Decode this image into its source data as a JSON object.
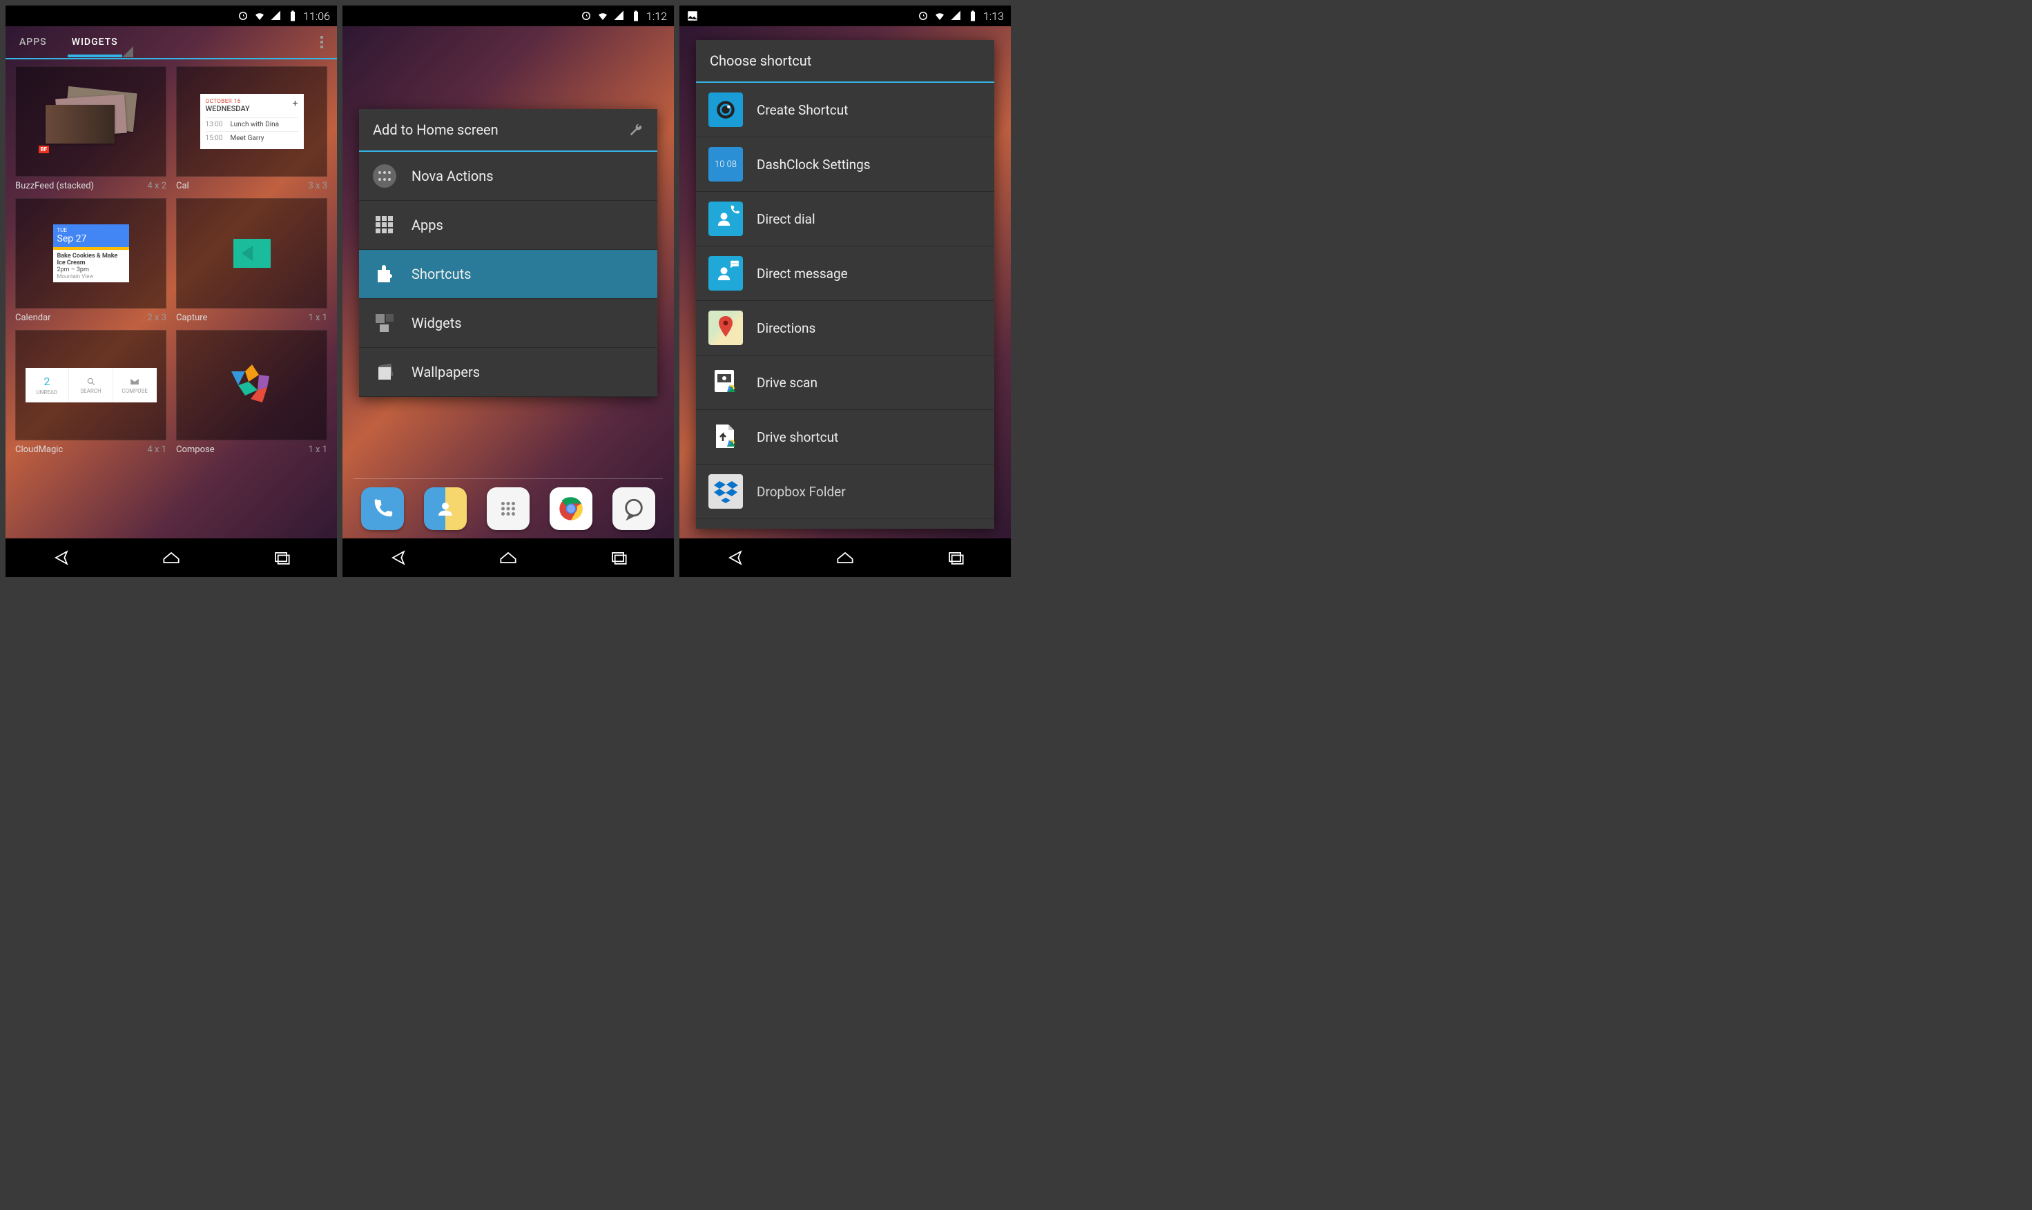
{
  "screen1": {
    "status": {
      "time": "11:06"
    },
    "tabs": {
      "apps": "APPS",
      "widgets": "WIDGETS",
      "active": "widgets"
    },
    "widgets": [
      {
        "name": "BuzzFeed (stacked)",
        "size": "4 x 2"
      },
      {
        "name": "Cal",
        "size": "3 x 3"
      },
      {
        "name": "Calendar",
        "size": "2 x 3"
      },
      {
        "name": "Capture",
        "size": "1 x 1"
      },
      {
        "name": "CloudMagic",
        "size": "4 x 1"
      },
      {
        "name": "Compose",
        "size": "1 x 1"
      }
    ],
    "cal_preview": {
      "header_small": "OCTOBER 16",
      "header_day": "WEDNESDAY",
      "rows": [
        {
          "t": "13:00",
          "e": "Lunch with Dina"
        },
        {
          "t": "15:00",
          "e": "Meet Garry"
        }
      ]
    },
    "gcal_preview": {
      "dow": "TUE",
      "date": "Sep 27",
      "event": "Bake Cookies & Make Ice Cream",
      "time": "2pm – 3pm",
      "loc": "Mountain View"
    },
    "cloudmagic": {
      "unread_n": "2",
      "unread": "UNREAD",
      "search": "SEARCH",
      "compose": "COMPOSE"
    }
  },
  "screen2": {
    "status": {
      "time": "1:12"
    },
    "dialog_title": "Add to Home screen",
    "items": [
      {
        "label": "Nova Actions",
        "icon": "dots"
      },
      {
        "label": "Apps",
        "icon": "grid"
      },
      {
        "label": "Shortcuts",
        "icon": "puzzle",
        "selected": true
      },
      {
        "label": "Widgets",
        "icon": "squares"
      },
      {
        "label": "Wallpapers",
        "icon": "stack"
      }
    ]
  },
  "screen3": {
    "status": {
      "time": "1:13"
    },
    "dialog_title": "Choose shortcut",
    "items": [
      {
        "label": "Create Shortcut",
        "color": "#1a9cd6"
      },
      {
        "label": "DashClock Settings",
        "color": "#2a8fd4"
      },
      {
        "label": "Direct dial",
        "color": "#1fa8d8"
      },
      {
        "label": "Direct message",
        "color": "#1fa8d8"
      },
      {
        "label": "Directions",
        "color": "#e8e8e8"
      },
      {
        "label": "Drive scan",
        "color": "#fff"
      },
      {
        "label": "Drive shortcut",
        "color": "#fff"
      },
      {
        "label": "Dropbox Folder",
        "color": "#fff"
      }
    ]
  }
}
